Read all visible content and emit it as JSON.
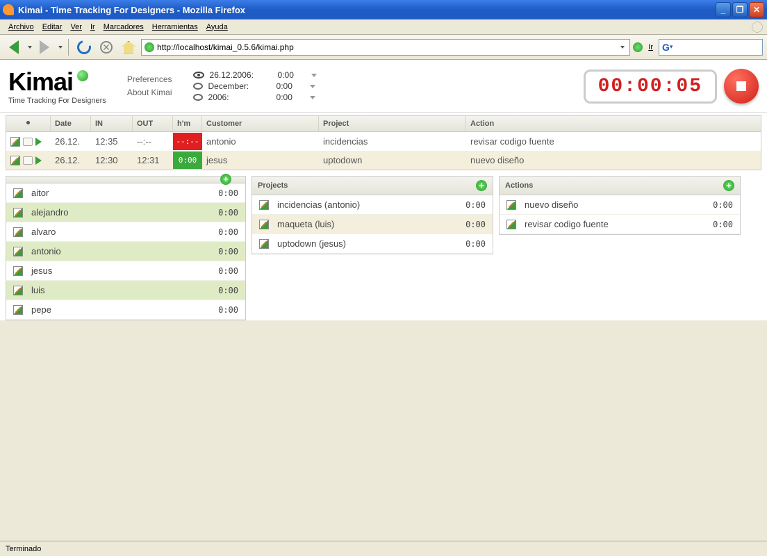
{
  "window": {
    "title": "Kimai - Time Tracking For Designers - Mozilla Firefox"
  },
  "menu": {
    "items": [
      "Archivo",
      "Editar",
      "Ver",
      "Ir",
      "Marcadores",
      "Herramientas",
      "Ayuda"
    ]
  },
  "nav": {
    "url": "http://localhost/kimai_0.5.6/kimai.php",
    "go_label": "Ir"
  },
  "logo": {
    "name": "Kimai",
    "tagline": "Time Tracking For Designers"
  },
  "header_links": {
    "prefs": "Preferences",
    "about": "About Kimai"
  },
  "stats": {
    "date_label": "26.12.2006:",
    "date_val": "0:00",
    "month_label": "December:",
    "month_val": "0:00",
    "year_label": "2006:",
    "year_val": "0:00"
  },
  "timer": "00:00:05",
  "columns": {
    "date": "Date",
    "in": "IN",
    "out": "OUT",
    "hm": "h'm",
    "customer": "Customer",
    "project": "Project",
    "action": "Action"
  },
  "entries": [
    {
      "date": "26.12.",
      "in": "12:35",
      "out": "--:--",
      "hm": "--:--",
      "hm_class": "hm-red",
      "customer": "antonio",
      "project": "incidencias",
      "action": "revisar codigo fuente"
    },
    {
      "date": "26.12.",
      "in": "12:30",
      "out": "12:31",
      "hm": "0:00",
      "hm_class": "hm-green",
      "customer": "jesus",
      "project": "uptodown",
      "action": "nuevo diseño"
    }
  ],
  "panels": {
    "projects_title": "Projects",
    "actions_title": "Actions"
  },
  "customers": [
    {
      "name": "aitor",
      "time": "0:00",
      "sel": false
    },
    {
      "name": "alejandro",
      "time": "0:00",
      "sel": true
    },
    {
      "name": "alvaro",
      "time": "0:00",
      "sel": false
    },
    {
      "name": "antonio",
      "time": "0:00",
      "sel": true
    },
    {
      "name": "jesus",
      "time": "0:00",
      "sel": false
    },
    {
      "name": "luis",
      "time": "0:00",
      "sel": true
    },
    {
      "name": "pepe",
      "time": "0:00",
      "sel": false
    }
  ],
  "projects": [
    {
      "name": "incidencias (antonio)",
      "time": "0:00",
      "sel": false
    },
    {
      "name": "maqueta (luis)",
      "time": "0:00",
      "sel": true
    },
    {
      "name": "uptodown (jesus)",
      "time": "0:00",
      "sel": false
    }
  ],
  "actions": [
    {
      "name": "nuevo diseño",
      "time": "0:00"
    },
    {
      "name": "revisar codigo fuente",
      "time": "0:00"
    }
  ],
  "status": "Terminado"
}
